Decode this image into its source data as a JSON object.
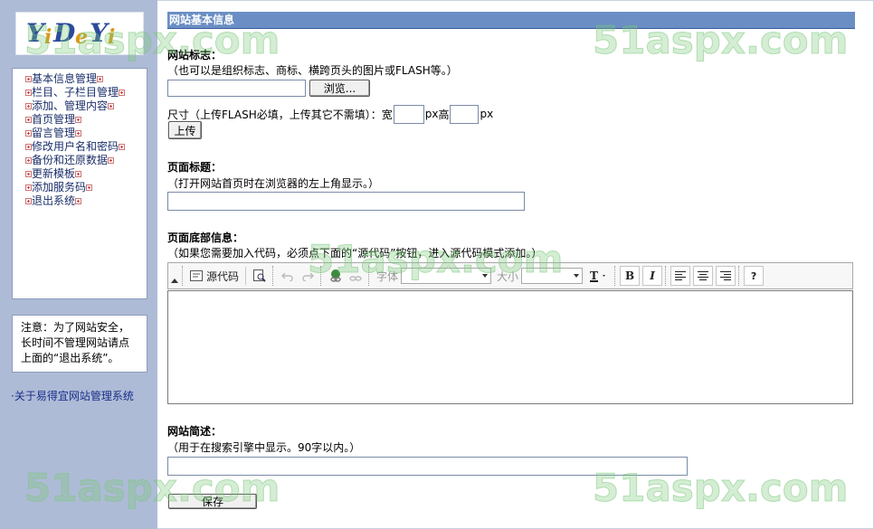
{
  "sidebar": {
    "logo_text": "YiDeYi",
    "nav_items": [
      "基本信息管理",
      "栏目、子栏目管理",
      "添加、管理内容",
      "首页管理",
      "留言管理",
      "修改用户名和密码",
      "备份和还原数据",
      "更新模板",
      "添加服务码",
      "退出系统"
    ],
    "notice_lines": [
      "注意：为了网站安全，",
      "长时间不管理网站请点",
      "上面的“退出系统”。"
    ],
    "about_link": "·关于易得宜网站管理系统"
  },
  "main": {
    "title": "网站基本信息",
    "logo_section": {
      "label": "网站标志：",
      "hint": "（也可以是组织标志、商标、横跨页头的图片或FLASH等。）",
      "browse_button": "浏览...",
      "size_prefix": "尺寸（上传FLASH必填，上传其它不需填）：宽",
      "px1": "px",
      "height_label": "高",
      "px2": "px",
      "upload_button": "上传"
    },
    "page_title_section": {
      "label": "页面标题：",
      "hint": "（打开网站首页时在浏览器的左上角显示。）"
    },
    "footer_section": {
      "label": "页面底部信息：",
      "hint": "（如果您需要加入代码，必须点下面的“源代码”按钮，进入源代码模式添加。）",
      "toolbar": {
        "source_label": "源代码",
        "font_label": "字体",
        "size_label": "大小",
        "bold": "B",
        "italic": "I",
        "help": "?"
      }
    },
    "description_section": {
      "label": "网站简述：",
      "hint": "（用于在搜索引擎中显示。90字以内。）"
    },
    "save_button": "保存"
  },
  "watermark": "51aspx.com"
}
